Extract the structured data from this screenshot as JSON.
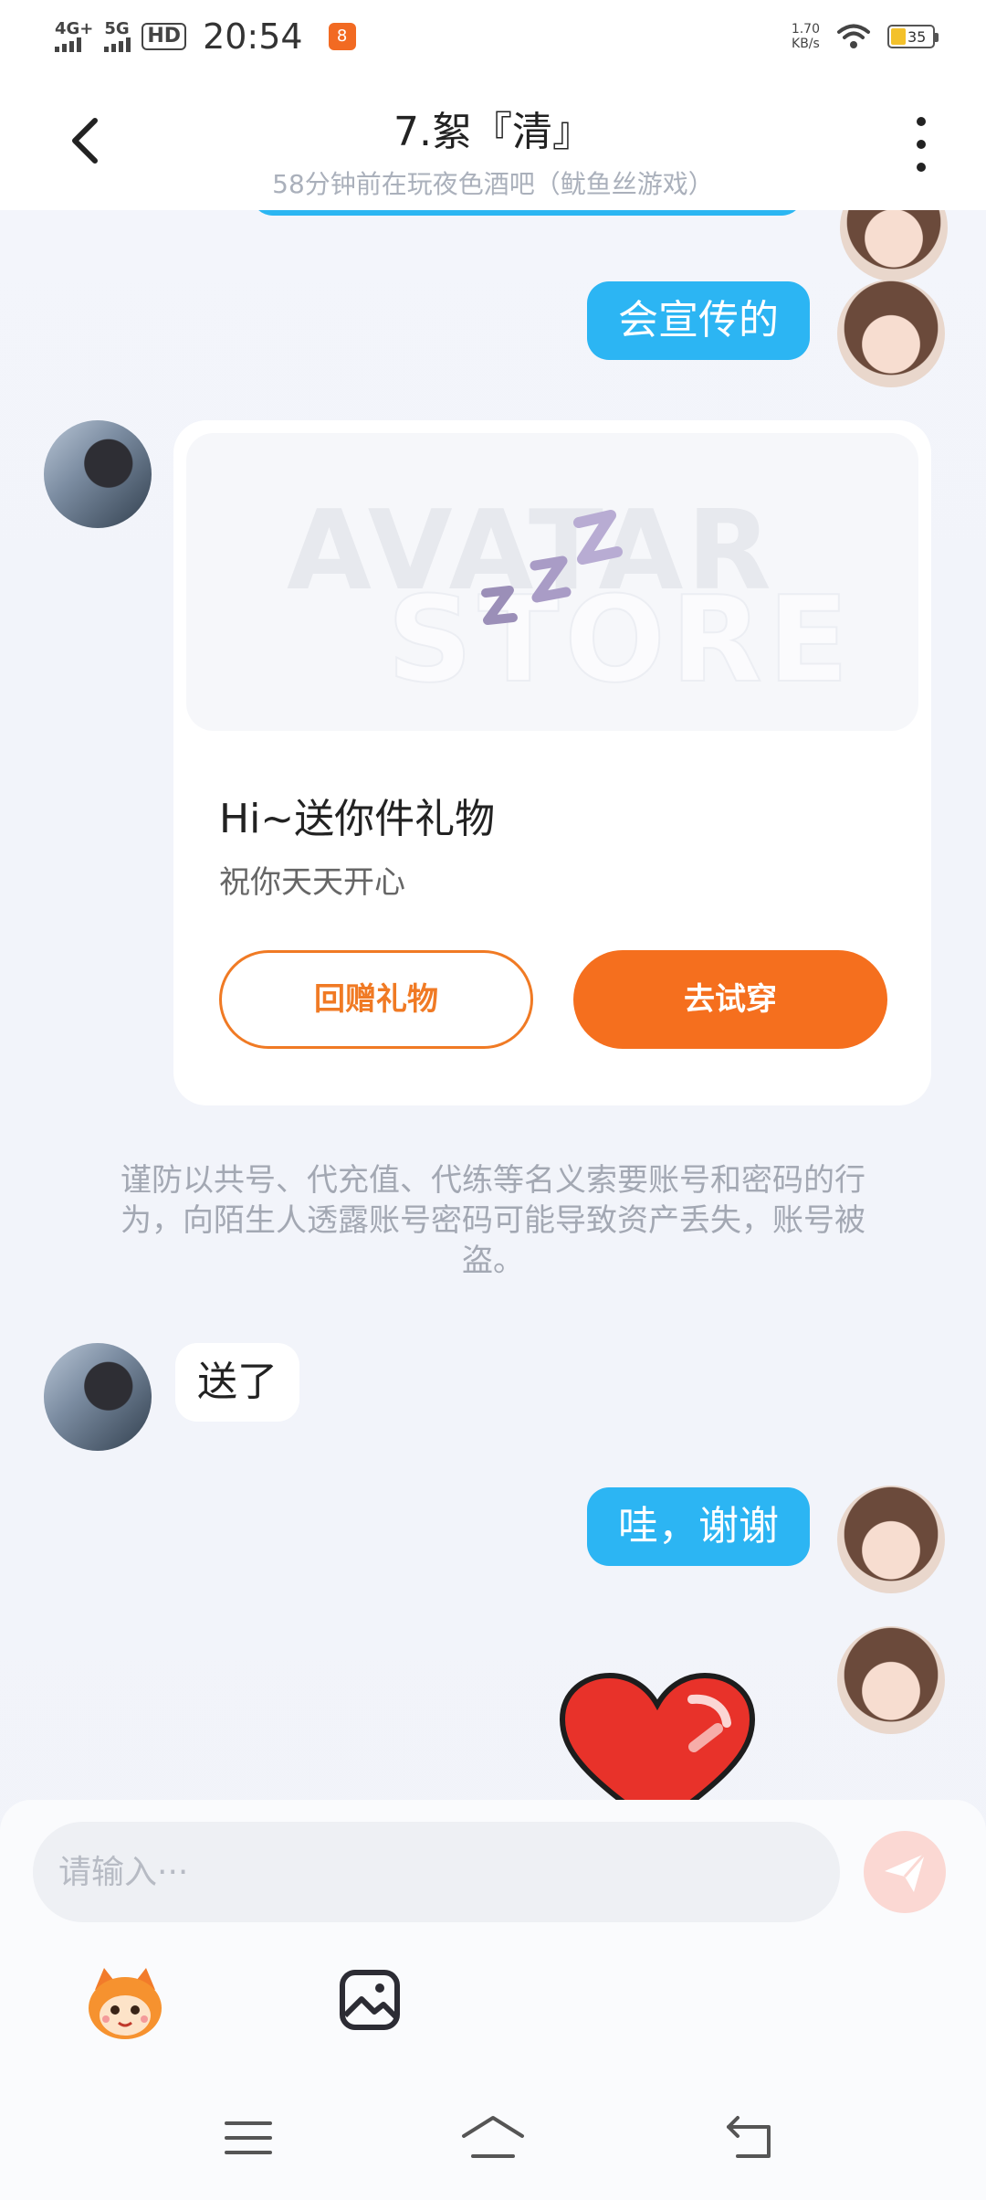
{
  "status_bar": {
    "signal1": "4G+",
    "signal2": "5G",
    "hd": "HD",
    "time": "20:54",
    "app_badge": "8",
    "speed_value": "1.70",
    "speed_unit": "KB/s",
    "battery": "35"
  },
  "header": {
    "title": "7.絮『清』",
    "subtitle": "58分钟前在玩夜色酒吧（鱿鱼丝游戏）"
  },
  "messages": {
    "m1": "会宣传的",
    "m2": "送了",
    "m3": "哇，谢谢"
  },
  "gift_card": {
    "title": "Hi~送你件礼物",
    "subtitle": "祝你天天开心",
    "watermark_1": "AVATAR",
    "watermark_2": "STORE",
    "return_gift_label": "回赠礼物",
    "try_on_label": "去试穿"
  },
  "warning": "谨防以共号、代充值、代练等名义索要账号和密码的行为，向陌生人透露账号密码可能导致资产丢失，账号被盗。",
  "input": {
    "placeholder": "请输入···"
  },
  "colors": {
    "bubble_blue": "#2cb5f3",
    "accent_orange": "#f56f1e"
  },
  "icons": [
    "back-icon",
    "more-icon",
    "send-icon",
    "mascot-icon",
    "image-icon",
    "menu-icon",
    "home-icon",
    "return-icon"
  ]
}
